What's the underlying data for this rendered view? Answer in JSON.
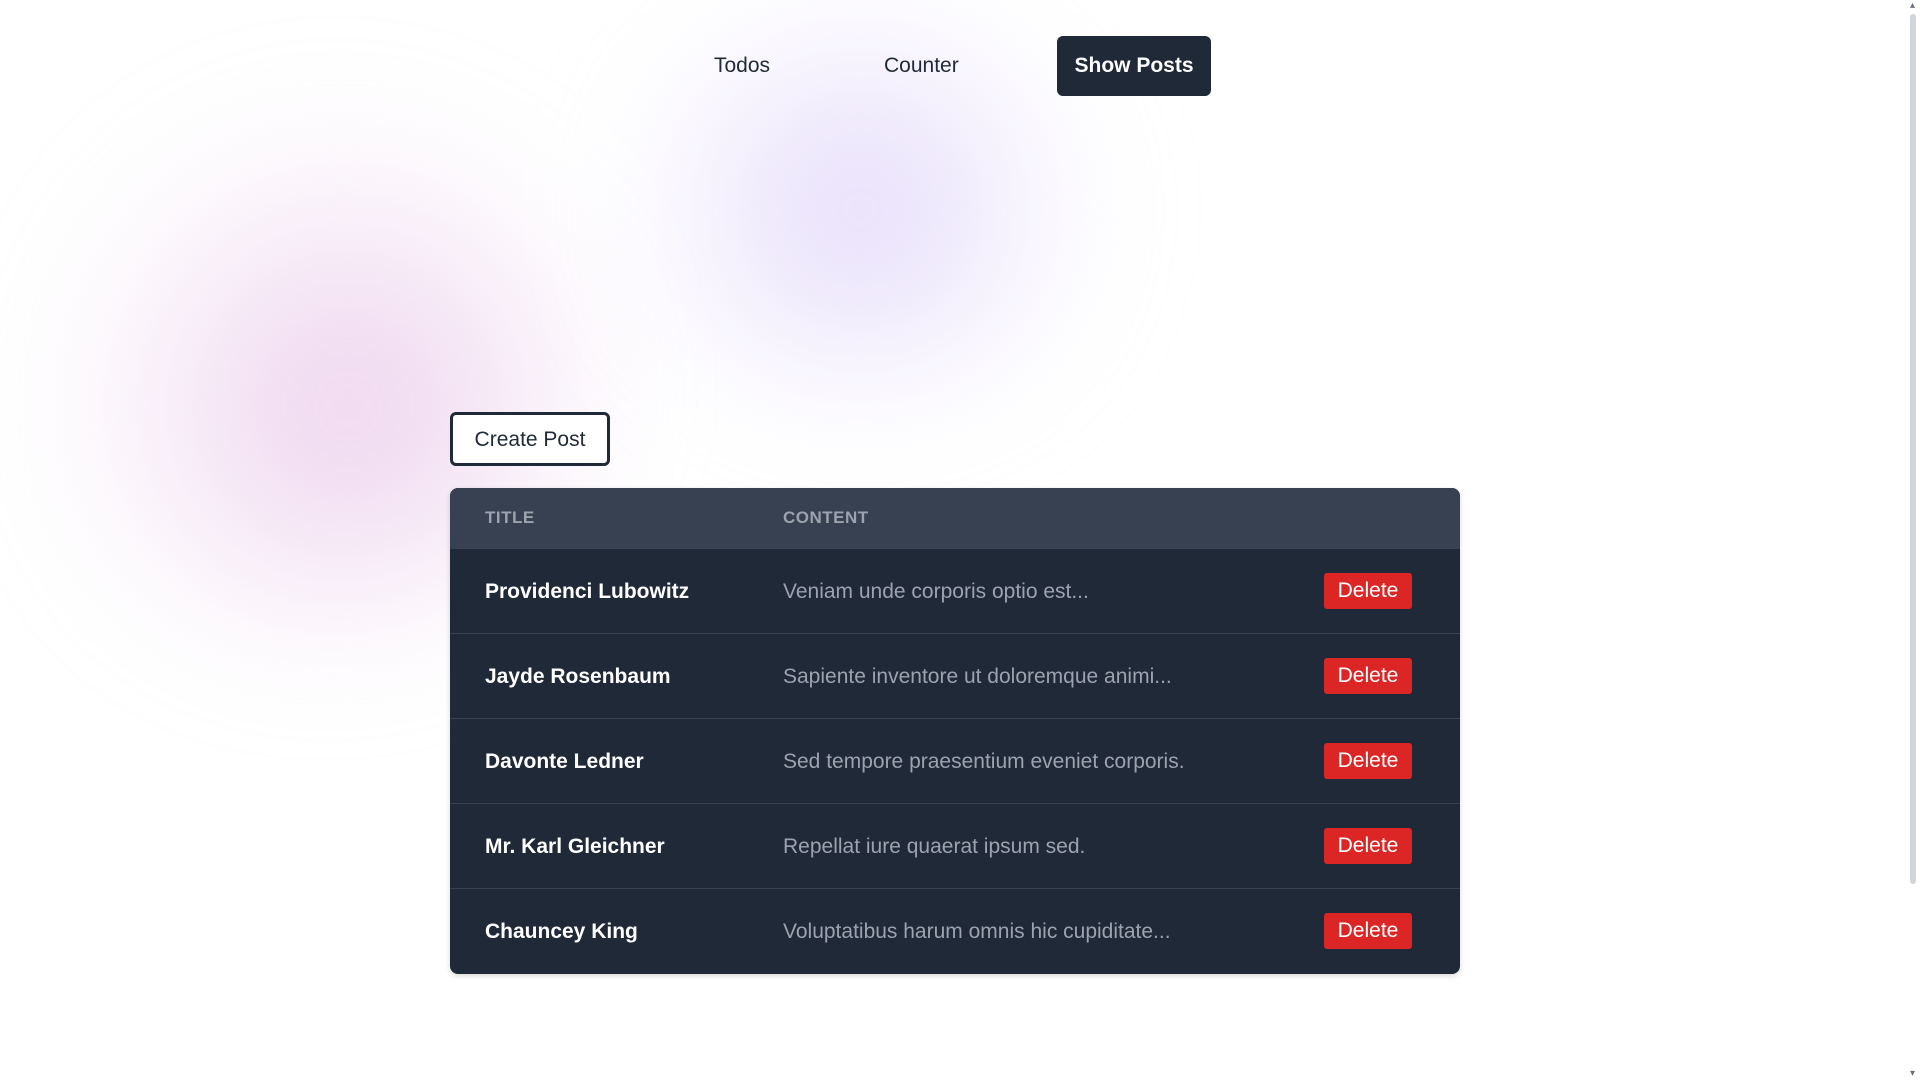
{
  "nav": {
    "todos": "Todos",
    "counter": "Counter",
    "show_posts": "Show Posts"
  },
  "actions": {
    "create_post": "Create Post"
  },
  "table": {
    "headers": {
      "title": "Title",
      "content": "Content"
    },
    "delete_label": "Delete",
    "rows": [
      {
        "title": "Providenci Lubowitz",
        "content": "Veniam unde corporis optio est..."
      },
      {
        "title": "Jayde Rosenbaum",
        "content": "Sapiente inventore ut doloremque animi..."
      },
      {
        "title": "Davonte Ledner",
        "content": "Sed tempore praesentium eveniet corporis."
      },
      {
        "title": "Mr. Karl Gleichner",
        "content": "Repellat iure quaerat ipsum sed."
      },
      {
        "title": "Chauncey King",
        "content": "Voluptatibus harum omnis hic cupiditate..."
      }
    ]
  },
  "scrollbar": {
    "up_icon": "▴",
    "down_icon": "▾"
  },
  "colors": {
    "nav_active_bg": "#1f2937",
    "table_bg": "#1f2937",
    "table_header_bg": "#374151",
    "delete_bg": "#dc2626",
    "content_text": "#9ca3af"
  }
}
